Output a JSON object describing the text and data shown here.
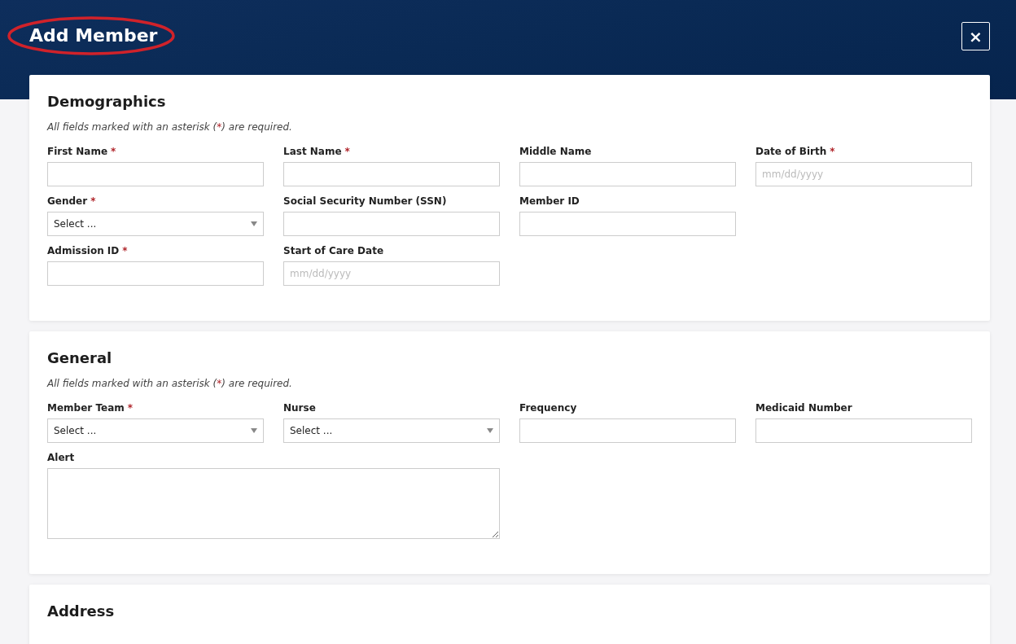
{
  "header": {
    "title": "Add Member",
    "close": "×"
  },
  "sections": [
    {
      "title": "Demographics",
      "note_before": "All fields marked with an asterisk (",
      "note_mark": "*",
      "note_after": ") are required.",
      "rows": [
        [
          {
            "kind": "text",
            "label": "First Name",
            "required_mark": "*"
          },
          {
            "kind": "text",
            "label": "Last Name",
            "required_mark": "*"
          },
          {
            "kind": "text",
            "label": "Middle Name"
          },
          {
            "kind": "text",
            "label": "Date of Birth",
            "required_mark": "*",
            "placeholder": "mm/dd/yyyy"
          }
        ],
        [
          {
            "kind": "select",
            "label": "Gender",
            "required_mark": "*",
            "value": "Select ..."
          },
          {
            "kind": "text",
            "label": "Social Security Number (SSN)"
          },
          {
            "kind": "text",
            "label": "Member ID"
          }
        ],
        [
          {
            "kind": "text",
            "label": "Admission ID",
            "required_mark": "*"
          },
          {
            "kind": "text",
            "label": "Start of Care Date",
            "placeholder": "mm/dd/yyyy"
          }
        ]
      ]
    },
    {
      "title": "General",
      "note_before": "All fields marked with an asterisk (",
      "note_mark": "*",
      "note_after": ") are required.",
      "rows": [
        [
          {
            "kind": "select",
            "label": "Member Team",
            "required_mark": "*",
            "value": "Select ..."
          },
          {
            "kind": "select",
            "label": "Nurse",
            "value": "Select ..."
          },
          {
            "kind": "text",
            "label": "Frequency"
          },
          {
            "kind": "text",
            "label": "Medicaid Number"
          }
        ],
        [
          {
            "kind": "textarea",
            "label": "Alert"
          }
        ]
      ]
    },
    {
      "title": "Address"
    }
  ]
}
